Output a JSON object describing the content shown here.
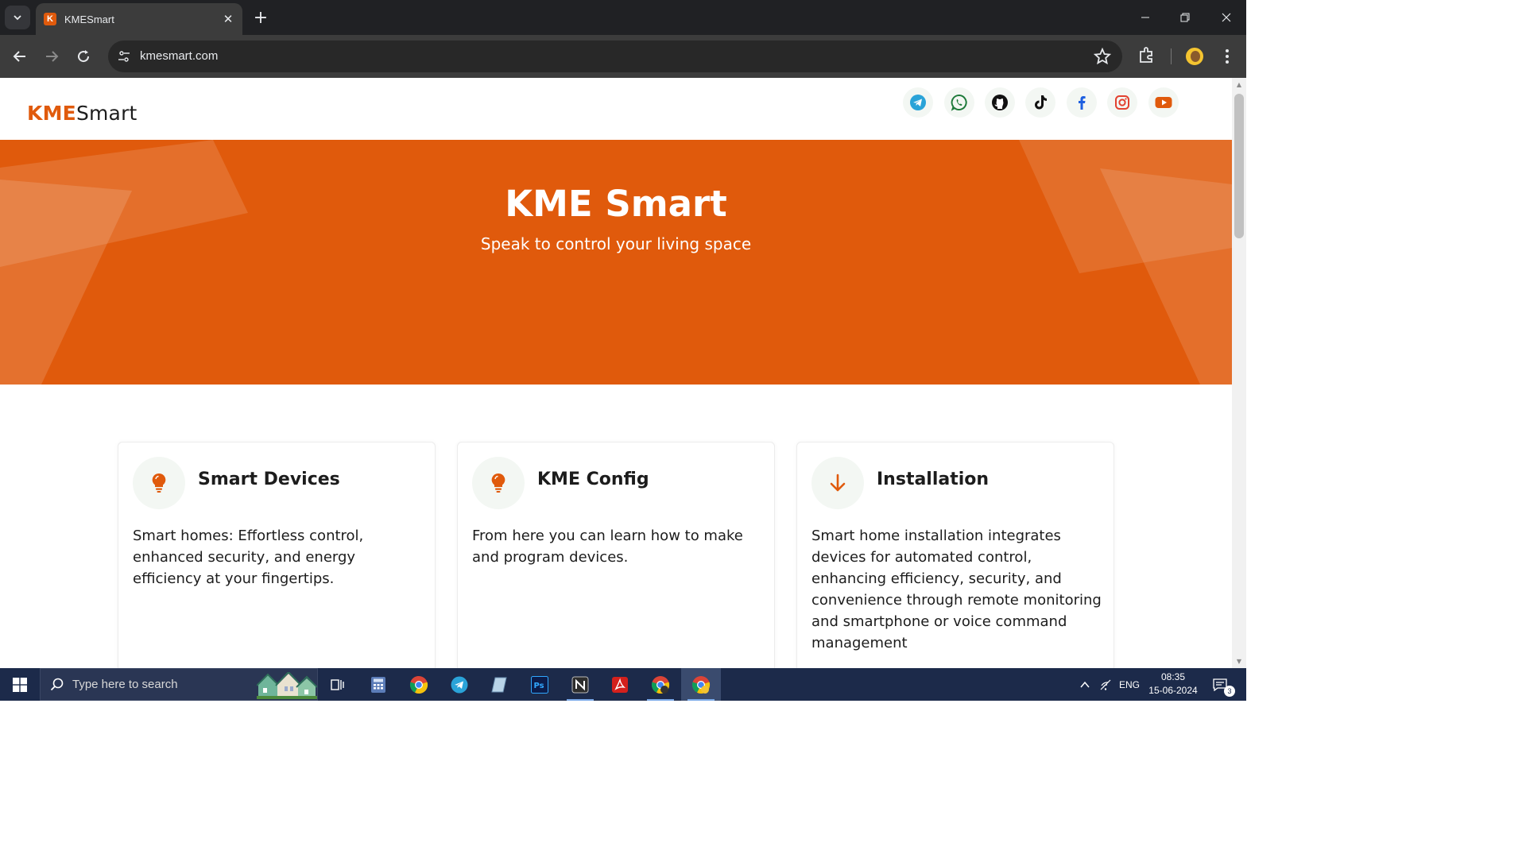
{
  "browser": {
    "tab_title": "KMESmart",
    "favicon_letter": "K",
    "url": "kmesmart.com"
  },
  "site": {
    "logo_accent": "KME",
    "logo_rest": "Smart",
    "social_icons": [
      "telegram-icon",
      "whatsapp-icon",
      "github-icon",
      "tiktok-icon",
      "facebook-icon",
      "instagram-icon",
      "youtube-icon"
    ]
  },
  "hero": {
    "title": "KME Smart",
    "subtitle": "Speak to control your living space"
  },
  "cards": [
    {
      "icon": "lightbulb-icon",
      "title": "Smart Devices",
      "text": "Smart homes: Effortless control, enhanced security, and energy efficiency at your fingertips."
    },
    {
      "icon": "lightbulb-icon",
      "title": "KME Config",
      "text": "From here you can learn how to make and program devices."
    },
    {
      "icon": "arrow-down-icon",
      "title": "Installation",
      "text": "Smart home installation integrates devices for automated control, enhancing efficiency, security, and convenience through remote monitoring and smartphone or voice command management"
    }
  ],
  "taskbar": {
    "search_placeholder": "Type here to search",
    "language": "ENG",
    "time": "08:35",
    "date": "15-06-2024",
    "notifications": "3"
  },
  "colors": {
    "accent": "#e05a0c",
    "taskbar": "#1c2a4a"
  }
}
